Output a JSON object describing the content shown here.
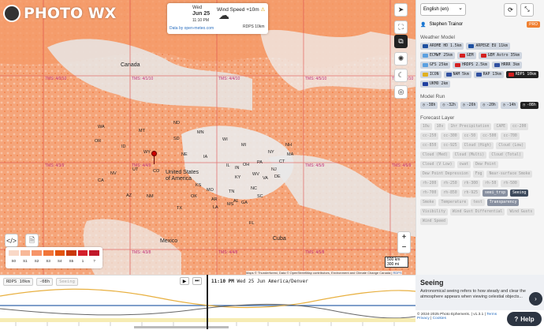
{
  "app": {
    "brand": "PHOTO WX"
  },
  "forecast_card": {
    "day": "Wed",
    "date": "Jun 25",
    "time": "11:10 PM",
    "source": "Data by open-meteo.com",
    "icon": "cloud-icon"
  },
  "wind": {
    "label": "Wind Speed +10m",
    "model": "RDPS 10km"
  },
  "grid_labels": [
    "TMS: 4/0/10",
    "TMS: 4/1/10",
    "TMS: 4/4/10",
    "TMS: 4/5/10",
    "TMS: 4/6/10",
    "TMS: 4/3/9",
    "TMS: 4/4/9",
    "TMS: 4/5/9",
    "TMS: 4/6/9",
    "TMS: 4/3/8",
    "TMS: 4/4/8",
    "TMS: 4/5/8"
  ],
  "places": {
    "countries": [
      "Canada",
      "United States of America",
      "Mexico",
      "Cuba"
    ],
    "states": [
      "WA",
      "OR",
      "ID",
      "MT",
      "WY",
      "ND",
      "SD",
      "MN",
      "NE",
      "IA",
      "WI",
      "MI",
      "NY",
      "NH",
      "MA",
      "CT",
      "CA",
      "NV",
      "UT",
      "CO",
      "KS",
      "MO",
      "IL",
      "IN",
      "OH",
      "PA",
      "NJ",
      "DE",
      "KY",
      "WV",
      "VA",
      "AZ",
      "NM",
      "OK",
      "AR",
      "TN",
      "NC",
      "TX",
      "LA",
      "MS",
      "AL",
      "GA",
      "SC",
      "FL"
    ]
  },
  "legend": {
    "labels": [
      "S0",
      "S1",
      "S2",
      "S3",
      "S4",
      "S5",
      "1",
      "?"
    ],
    "colors": [
      "#f9d8c6",
      "#f8b898",
      "#f69468",
      "#f27538",
      "#e3540f",
      "#c9380a",
      "#d41e2a",
      "#c0182a"
    ]
  },
  "scale": {
    "km": "500 km",
    "mi": "300 mi"
  },
  "attribution": {
    "text": "Maps © Thunderforest, Data © OpenStreetMap contributors, Environment and Climate Change Canada",
    "rdps": "RDPS"
  },
  "toolbar_left": {
    "code_icon": "code-icon",
    "pdf_icon": "file-icon"
  },
  "panel": {
    "language": "English (en)",
    "user": "Stephen Trainor",
    "pro": "PRO",
    "weather_model_title": "Weather Model",
    "models": [
      {
        "label": "AROME HD 1.5km",
        "flag": "#1e50a0",
        "state": "normal"
      },
      {
        "label": "ARPEGE EU 11km",
        "flag": "#1e50a0",
        "state": "normal"
      },
      {
        "label": "ECMWF 25km",
        "flag": "#5ba0e0",
        "state": "normal"
      },
      {
        "label": "GEM",
        "flag": "#d42020",
        "state": "normal"
      },
      {
        "label": "GEM Astro 35km",
        "flag": "#d42020",
        "state": "normal"
      },
      {
        "label": "GFS 25km",
        "flag": "#5ba0e0",
        "state": "normal"
      },
      {
        "label": "HRDPS 2.5km",
        "flag": "#d42020",
        "state": "normal"
      },
      {
        "label": "HRRR 3km",
        "flag": "#3050a0",
        "state": "normal"
      },
      {
        "label": "ICON",
        "flag": "#e0b020",
        "state": "normal"
      },
      {
        "label": "NAM 5km",
        "flag": "#3050a0",
        "state": "normal"
      },
      {
        "label": "RAP 13km",
        "flag": "#3050a0",
        "state": "normal"
      },
      {
        "label": "RDPS 10km",
        "flag": "#d42020",
        "state": "on"
      },
      {
        "label": "UKMO 2km",
        "flag": "#2040a0",
        "state": "normal"
      }
    ],
    "model_run_title": "Model Run",
    "runs": [
      {
        "label": "-38h",
        "state": "normal"
      },
      {
        "label": "-32h",
        "state": "normal"
      },
      {
        "label": "-26h",
        "state": "normal"
      },
      {
        "label": "-20h",
        "state": "normal"
      },
      {
        "label": "-14h",
        "state": "normal"
      },
      {
        "label": "-08h",
        "state": "on"
      }
    ],
    "forecast_layer_title": "Forecast Layer",
    "layers": [
      {
        "label": "10u",
        "state": "off"
      },
      {
        "label": "10v",
        "state": "off"
      },
      {
        "label": "1hr Precipitation",
        "state": "off"
      },
      {
        "label": "CAPE",
        "state": "off"
      },
      {
        "label": "cc-200",
        "state": "off"
      },
      {
        "label": "cc-250",
        "state": "off"
      },
      {
        "label": "cc-300",
        "state": "off"
      },
      {
        "label": "cc-50",
        "state": "off"
      },
      {
        "label": "cc-500",
        "state": "off"
      },
      {
        "label": "cc-700",
        "state": "off"
      },
      {
        "label": "cc-850",
        "state": "off"
      },
      {
        "label": "cc-925",
        "state": "off"
      },
      {
        "label": "Cloud (High)",
        "state": "off"
      },
      {
        "label": "Cloud (Low)",
        "state": "off"
      },
      {
        "label": "Cloud (Med)",
        "state": "off"
      },
      {
        "label": "Cloud (Multi)",
        "state": "off"
      },
      {
        "label": "Cloud (Total)",
        "state": "off"
      },
      {
        "label": "Cloud (V Low)",
        "state": "off"
      },
      {
        "label": "cwat",
        "state": "off"
      },
      {
        "label": "Dew Point",
        "state": "off"
      },
      {
        "label": "Dew Point Depression",
        "state": "off"
      },
      {
        "label": "Fog",
        "state": "off"
      },
      {
        "label": "Near-surface Smoke",
        "state": "off"
      },
      {
        "label": "rh-200",
        "state": "off"
      },
      {
        "label": "rh-250",
        "state": "off"
      },
      {
        "label": "rh-300",
        "state": "off"
      },
      {
        "label": "rh-50",
        "state": "off"
      },
      {
        "label": "rh-500",
        "state": "off"
      },
      {
        "label": "rh-700",
        "state": "off"
      },
      {
        "label": "rh-850",
        "state": "off"
      },
      {
        "label": "rh-925",
        "state": "off"
      },
      {
        "label": "seei_trsp",
        "state": "sel2"
      },
      {
        "label": "Seeing",
        "state": "sel"
      },
      {
        "label": "Smoke",
        "state": "off"
      },
      {
        "label": "Temperature",
        "state": "off"
      },
      {
        "label": "test",
        "state": "off"
      },
      {
        "label": "Transparency",
        "state": "sel2"
      },
      {
        "label": "Visibility",
        "state": "off"
      },
      {
        "label": "Wind Gust Differential",
        "state": "off"
      },
      {
        "label": "Wind Gusts",
        "state": "off"
      },
      {
        "label": "Wind Speed",
        "state": "off"
      }
    ]
  },
  "timeline": {
    "model": "RDPS 10km",
    "run": "-08h",
    "layer": "Seeing",
    "time": "11:10 PM",
    "date": "Wed 25 Jun America/Denver"
  },
  "seeing_info": {
    "title": "Seeing",
    "body": "Astronomical seeing refers to how steady and clear the atmosphere appears when viewing celestial objects..."
  },
  "footer": {
    "copyright": "© 2024-2025 Photo Ephemeris.",
    "version": "v1.3.1",
    "terms": "Terms",
    "privacy": "Privacy",
    "cookies": "Cookies"
  },
  "help": {
    "label": "Help"
  }
}
